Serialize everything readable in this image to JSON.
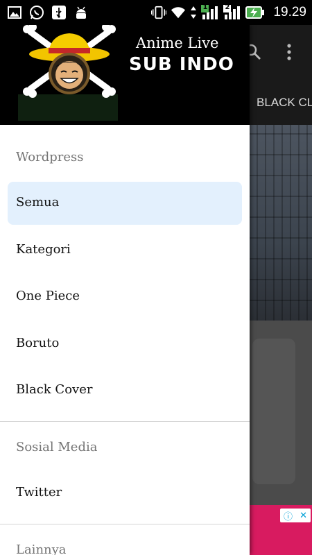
{
  "status_bar": {
    "time": "19.29",
    "sim1": "1",
    "sim2": "2",
    "left_icons": [
      "image-icon",
      "whatsapp-icon",
      "usb-icon",
      "android-icon"
    ],
    "right_icons": [
      "vibrate-icon",
      "wifi-icon",
      "data-arrows-icon",
      "signal-sim1-icon",
      "signal-sim2-icon",
      "battery-charging-icon"
    ]
  },
  "drawer": {
    "brand": {
      "title": "Anime Live",
      "subtitle": "SUB INDO",
      "logo": "straw-hat-skull-logo"
    },
    "sections": [
      {
        "label": "Wordpress",
        "items": [
          {
            "label": "Semua",
            "active": true
          },
          {
            "label": "Kategori",
            "active": false
          },
          {
            "label": "One Piece",
            "active": false
          },
          {
            "label": "Boruto",
            "active": false
          },
          {
            "label": "Black Cover",
            "active": false
          }
        ]
      },
      {
        "label": "Sosial Media",
        "items": [
          {
            "label": "Twitter",
            "active": false
          }
        ]
      },
      {
        "label": "Lainnya",
        "items": []
      }
    ]
  },
  "app": {
    "toolbar_icons": [
      "search-icon",
      "more-vert-icon"
    ],
    "tab_visible": "BLACK CL",
    "ad_badge_icons": [
      "info-icon",
      "close-icon"
    ],
    "colors": {
      "drawer_active": "#e3f0fd",
      "ad_strip": "#d81b60",
      "battery": "#4caf50",
      "sim_badge": "#4caf50"
    }
  }
}
